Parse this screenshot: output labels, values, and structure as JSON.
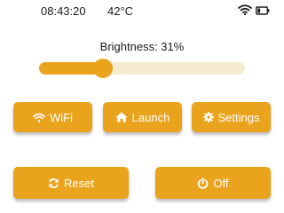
{
  "status": {
    "time": "08:43:20",
    "temperature": "42°C",
    "icons": [
      "wifi-icon",
      "battery-icon"
    ],
    "battery_level_fraction": 0.3
  },
  "brightness": {
    "label": "Brightness: 31%",
    "value_percent": 31
  },
  "buttons": {
    "wifi": {
      "label": "WiFi",
      "icon": "wifi-icon"
    },
    "launch": {
      "label": "Launch",
      "icon": "home-icon"
    },
    "settings": {
      "label": "Settings",
      "icon": "gear-icon"
    },
    "reset": {
      "label": "Reset",
      "icon": "refresh-icon"
    },
    "off": {
      "label": "Off",
      "icon": "power-icon"
    }
  },
  "colors": {
    "accent": "#eaa31c",
    "track": "#f5ecd0",
    "button_text": "#ffffff",
    "text": "#1a1a1a"
  }
}
